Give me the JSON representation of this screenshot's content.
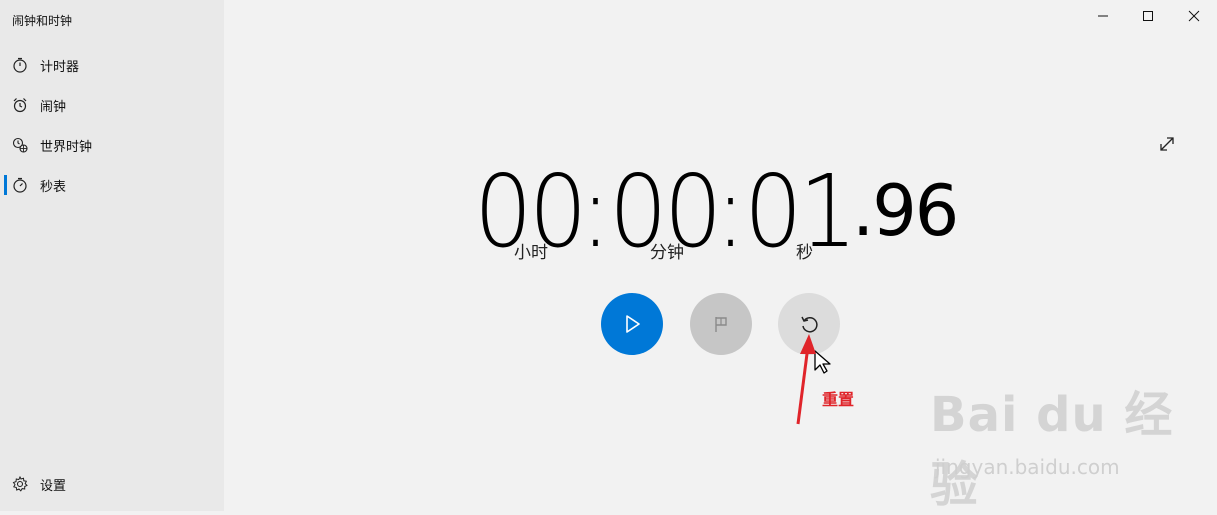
{
  "app": {
    "title": "闹钟和时钟"
  },
  "sidebar": {
    "items": [
      {
        "label": "计时器",
        "icon": "timer-icon"
      },
      {
        "label": "闹钟",
        "icon": "alarm-icon"
      },
      {
        "label": "世界时钟",
        "icon": "world-clock-icon"
      },
      {
        "label": "秒表",
        "icon": "stopwatch-icon",
        "selected": true
      }
    ],
    "settings_label": "设置"
  },
  "stopwatch": {
    "hours": "00",
    "sep1": ":",
    "minutes": "00",
    "sep2": ":",
    "seconds": "01",
    "fraction": ".96",
    "unit_hours": "小时",
    "unit_minutes": "分钟",
    "unit_seconds": "秒"
  },
  "controls": {
    "play": "play-icon",
    "lap": "flag-icon",
    "reset": "reset-icon"
  },
  "annotation": {
    "label": "重置",
    "color": "#e0242a"
  },
  "watermark": {
    "logo": "Bai du 经验",
    "url": "jingyan.baidu.com"
  },
  "colors": {
    "accent": "#0078d7",
    "sidebar_bg": "#e9e9e9",
    "main_bg": "#f2f2f2"
  }
}
